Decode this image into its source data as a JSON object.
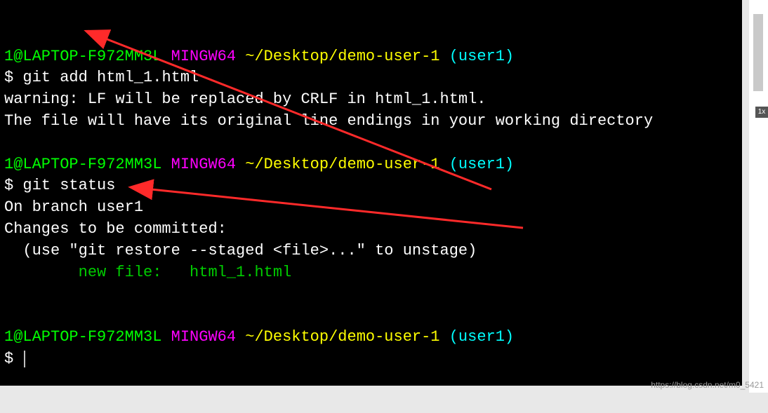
{
  "prompt": {
    "user_host": "1@LAPTOP-F972MM3L",
    "env": "MINGW64",
    "path": "~/Desktop/demo-user-1",
    "branch": "(user1)",
    "symbol": "$"
  },
  "block1": {
    "command": "git add html_1.html",
    "out1": "warning: LF will be replaced by CRLF in html_1.html.",
    "out2": "The file will have its original line endings in your working directory"
  },
  "block2": {
    "command": "git status",
    "out1": "On branch user1",
    "out2": "Changes to be committed:",
    "out3": "  (use \"git restore --staged <file>...\" to unstage)",
    "staged": "        new file:   html_1.html"
  },
  "side": {
    "tag": "1x"
  },
  "watermark": "https://blog.csdn.net/m0_5421"
}
